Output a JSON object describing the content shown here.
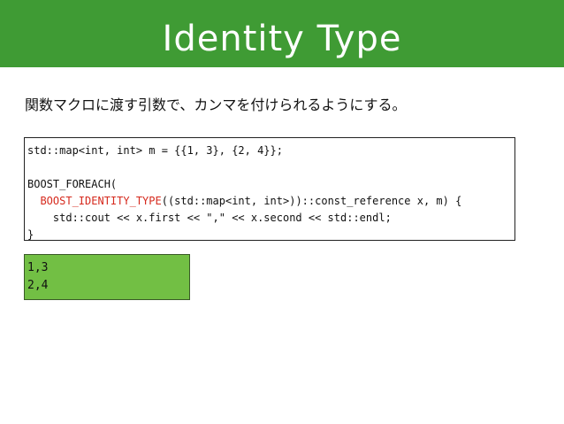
{
  "slide": {
    "title": "Identity Type",
    "subtitle": "関数マクロに渡す引数で、カンマを付けられるようにする。"
  },
  "code": {
    "line1": "std::map<int, int> m = {{1, 3}, {2, 4}};",
    "line2": "",
    "line3": "BOOST_FOREACH(",
    "line4_indent": "  ",
    "line4_macro": "BOOST_IDENTITY_TYPE",
    "line4_rest": "((std::map<int, int>))::const_reference x, m) {",
    "line5": "    std::cout << x.first << \",\" << x.second << std::endl;",
    "line6": "}"
  },
  "output": {
    "line1": "1,3",
    "line2": "2,4"
  },
  "colors": {
    "title_bar": "#3f9b34",
    "macro_highlight": "#d62a1e",
    "output_background": "#72bf44"
  }
}
